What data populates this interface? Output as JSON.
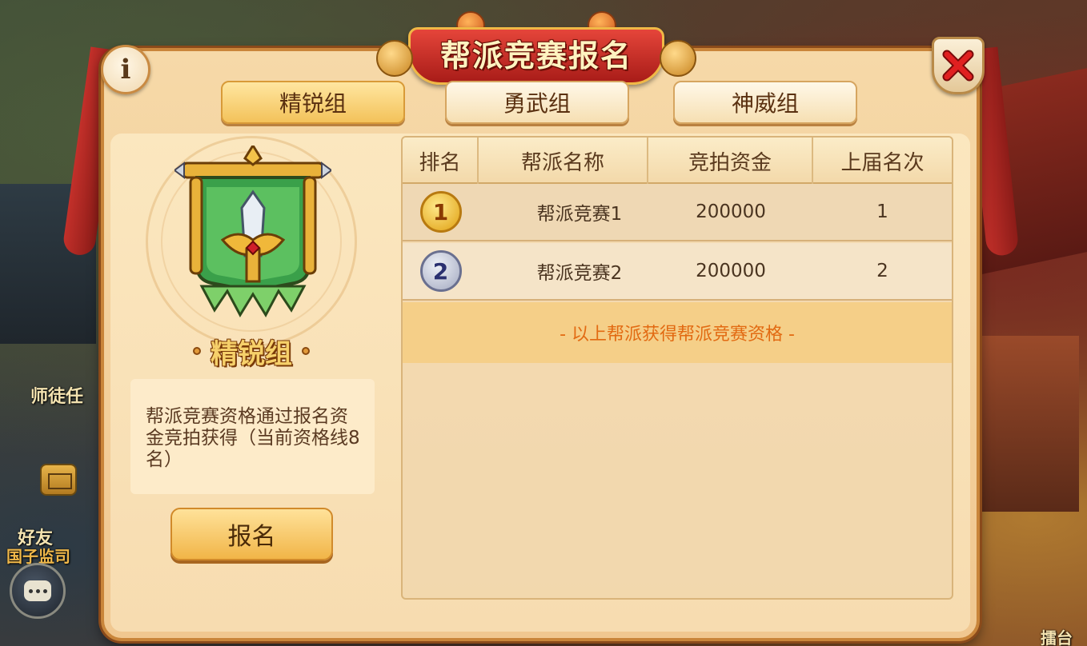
{
  "world": {
    "labels": {
      "mentor": "师徒任",
      "friend": "好友",
      "academy": "国子监司",
      "arena": "擂台"
    }
  },
  "dialog": {
    "title": "帮派竞赛报名",
    "tabs": [
      {
        "label": "精锐组",
        "active": true
      },
      {
        "label": "勇武组",
        "active": false
      },
      {
        "label": "神威组",
        "active": false
      }
    ]
  },
  "left_panel": {
    "group_name": "精锐组",
    "description": "帮派竞赛资格通过报名资金竞拍获得（当前资格线8名）",
    "signup_label": "报名"
  },
  "table": {
    "headers": [
      "排名",
      "帮派名称",
      "竞拍资金",
      "上届名次"
    ],
    "rows": [
      {
        "rank": "1",
        "name": "帮派竞赛1",
        "funds": "200000",
        "last_rank": "1"
      },
      {
        "rank": "2",
        "name": "帮派竞赛2",
        "funds": "200000",
        "last_rank": "2"
      }
    ],
    "qualification_note": "- 以上帮派获得帮派竞赛资格 -"
  },
  "colors": {
    "accent_orange": "#e26a12",
    "banner_red": "#c3302a",
    "gold": "#f1b548"
  }
}
